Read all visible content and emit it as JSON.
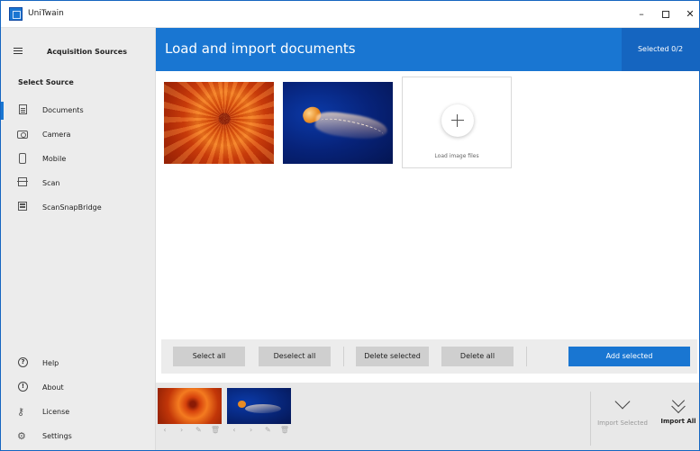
{
  "window": {
    "title": "UniTwain",
    "minimize": "–",
    "close": "✕"
  },
  "sidebar": {
    "title": "Acquisition Sources",
    "section": "Select Source",
    "sources": [
      {
        "label": "Documents",
        "icon": "document-icon",
        "selected": true
      },
      {
        "label": "Camera",
        "icon": "camera-icon"
      },
      {
        "label": "Mobile",
        "icon": "mobile-icon"
      },
      {
        "label": "Scan",
        "icon": "scanner-icon"
      },
      {
        "label": "ScanSnapBridge",
        "icon": "scansnap-icon"
      }
    ],
    "footer": [
      {
        "label": "Help",
        "icon": "help-icon",
        "glyph": "?"
      },
      {
        "label": "About",
        "icon": "info-icon",
        "glyph": "!"
      },
      {
        "label": "License",
        "icon": "key-icon",
        "glyph": "⚷"
      },
      {
        "label": "Settings",
        "icon": "gear-icon",
        "glyph": "⚙"
      }
    ]
  },
  "header": {
    "title": "Load and import documents",
    "selected": "Selected 0/2"
  },
  "gallery": {
    "load_label": "Load image files"
  },
  "toolbar": {
    "select_all": "Select all",
    "deselect_all": "Deselect all",
    "delete_selected": "Delete selected",
    "delete_all": "Delete all",
    "add_selected": "Add selected"
  },
  "strip": {
    "controls": [
      "‹",
      "›",
      "✎",
      "🗑"
    ],
    "import_selected": "Import Selected",
    "import_all": "Import All"
  },
  "colors": {
    "accent": "#1976d2",
    "accent_dark": "#1565c0",
    "sidebar_bg": "#ececec"
  }
}
